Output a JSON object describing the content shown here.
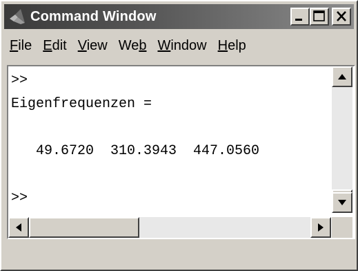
{
  "window": {
    "title": "Command Window",
    "icon": "matlab-logo-icon"
  },
  "menu": {
    "items": [
      {
        "pre": "",
        "key": "F",
        "post": "ile"
      },
      {
        "pre": "",
        "key": "E",
        "post": "dit"
      },
      {
        "pre": "",
        "key": "V",
        "post": "iew"
      },
      {
        "pre": "We",
        "key": "b",
        "post": ""
      },
      {
        "pre": "",
        "key": "W",
        "post": "indow"
      },
      {
        "pre": "",
        "key": "H",
        "post": "elp"
      }
    ]
  },
  "console": {
    "lines": [
      ">>",
      "Eigenfrequenzen =",
      "",
      "   49.6720  310.3943  447.0560",
      "",
      ">>"
    ]
  },
  "colors": {
    "title_start": "#3a3a3a",
    "title_end": "#8c8c8c",
    "chrome": "#d4d0c8"
  }
}
